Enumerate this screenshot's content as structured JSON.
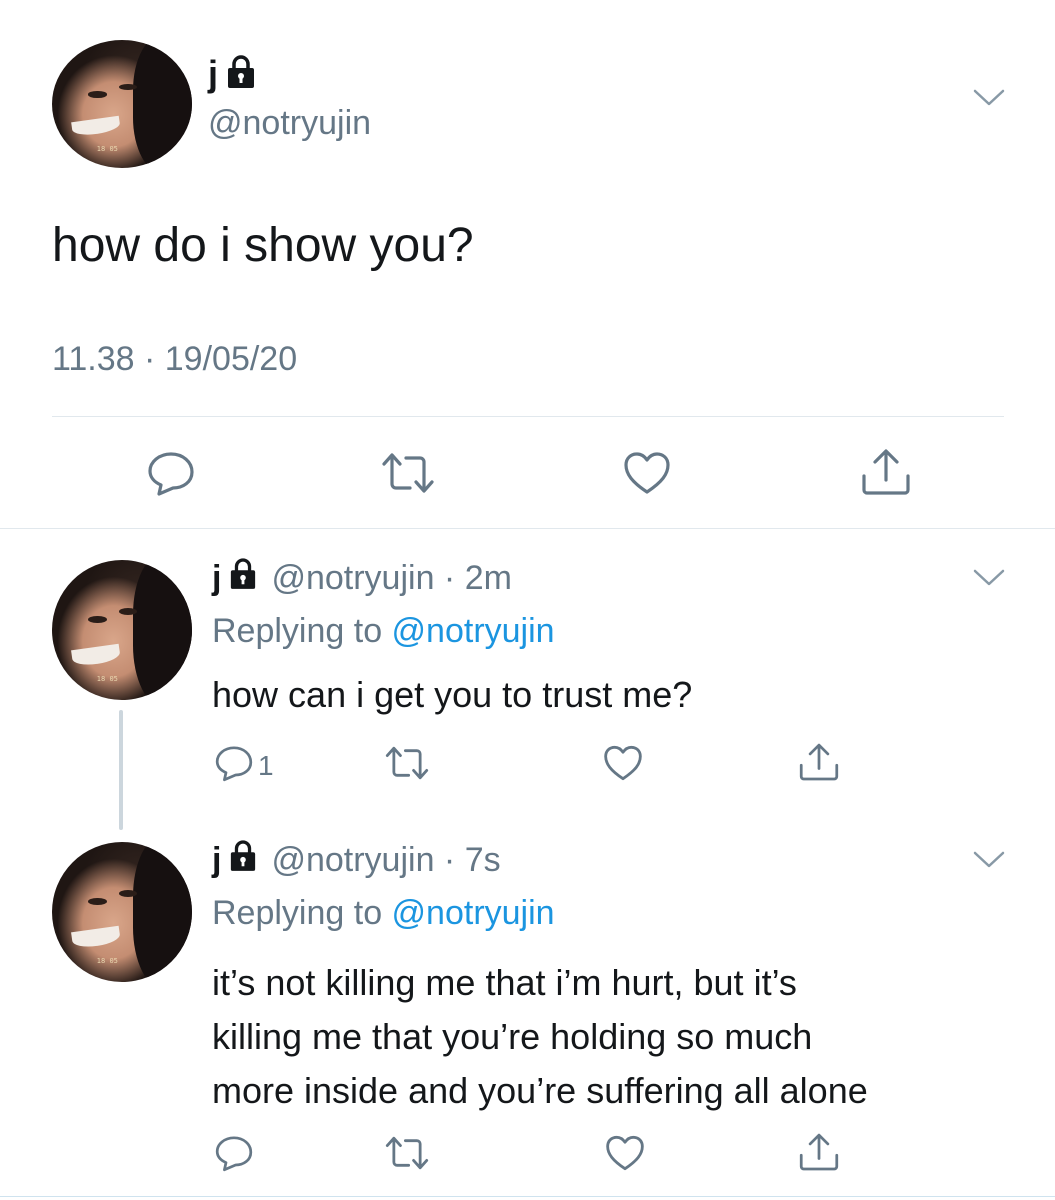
{
  "main_tweet": {
    "display_name": "j",
    "handle": "@notryujin",
    "text": "how do i show you?",
    "timestamp": "11.38 · 19/05/20"
  },
  "replies": [
    {
      "display_name": "j",
      "handle_time": "@notryujin · 2m",
      "replying_prefix": "Replying to ",
      "replying_handle": "@notryujin",
      "text": "how can i get you to trust me?",
      "reply_count": "1"
    },
    {
      "display_name": "j",
      "handle_time": "@notryujin · 7s",
      "replying_prefix": "Replying to ",
      "replying_handle": "@notryujin",
      "text_lines": [
        "it’s not killing me that i’m hurt, but it’s",
        "killing me that you’re holding so much",
        "more inside and you’re suffering all alone"
      ],
      "reply_count": ""
    }
  ],
  "icons": {
    "lock": "lock-icon",
    "more": "chevron-down-icon",
    "reply": "reply-icon",
    "retweet": "retweet-icon",
    "like": "heart-icon",
    "share": "share-icon"
  },
  "colors": {
    "text": "#14171a",
    "secondary": "#657786",
    "link": "#1b95e0",
    "divider": "#e1e8ed"
  }
}
